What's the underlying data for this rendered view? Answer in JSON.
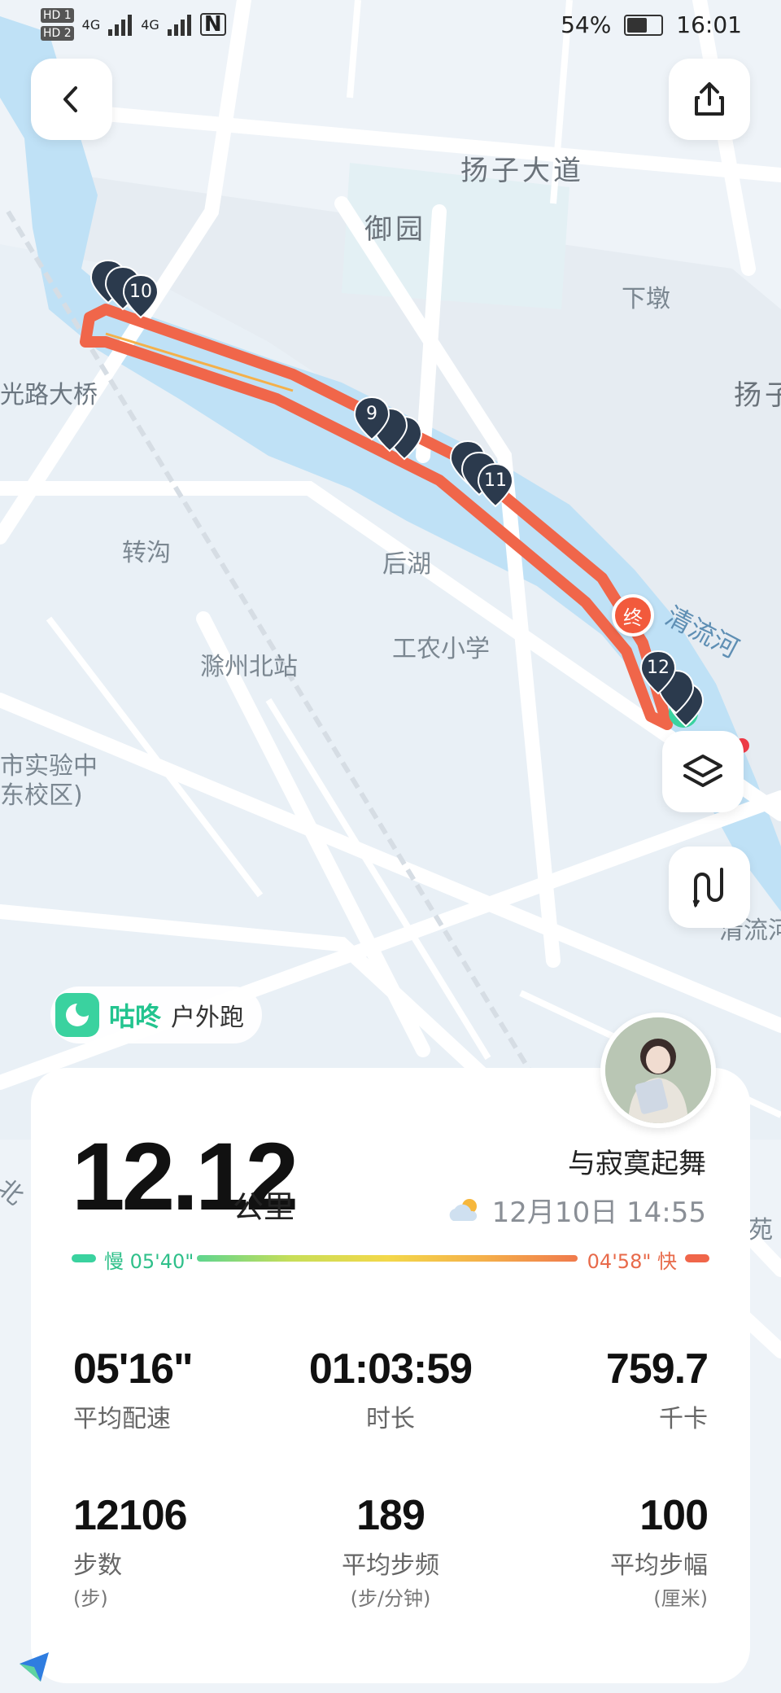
{
  "status_bar": {
    "hd1": "HD 1",
    "hd2": "HD 2",
    "signal1": "4G",
    "signal2": "4G",
    "nfc": "N",
    "battery": "54%",
    "time": "16:01"
  },
  "map": {
    "labels": {
      "yangzi_avenue": "扬子大道",
      "yuyuan": "御园",
      "xiadun": "下墩",
      "yangzi_right": "扬子",
      "bridge": "光路大桥",
      "zhuangou": "转沟",
      "houhu": "后湖",
      "gongnong_school": "工农小学",
      "chuzhou_north_station": "滁州北站",
      "school_line1": "市实验中",
      "school_line2": "东校区)",
      "qingliu_river": "清流河",
      "qingliu_river_2": "清流河",
      "bei_left": "北",
      "yuan_right": "苑"
    },
    "markers": {
      "km10": "10",
      "km9": "9",
      "km11": "11",
      "km12": "12",
      "end": "终"
    },
    "colors": {
      "route": "#f0664a",
      "water": "#bfe1f6",
      "end_marker": "#f25a3c",
      "start_marker": "#3ad29f",
      "pin": "#2b3a4d"
    }
  },
  "app": {
    "name": "咕咚",
    "activity": "户外跑"
  },
  "summary": {
    "distance": "12.12",
    "distance_unit": "公里",
    "username": "与寂寞起舞",
    "datetime": "12月10日 14:55",
    "pace_slow_label": "慢 05'40\"",
    "pace_fast_label": "04'58\" 快"
  },
  "stats": [
    {
      "value": "05'16\"",
      "label": "平均配速",
      "sub": ""
    },
    {
      "value": "01:03:59",
      "label": "时长",
      "sub": ""
    },
    {
      "value": "759.7",
      "label": "千卡",
      "sub": ""
    },
    {
      "value": "12106",
      "label": "步数",
      "sub": "(步)"
    },
    {
      "value": "189",
      "label": "平均步频",
      "sub": "(步/分钟)"
    },
    {
      "value": "100",
      "label": "平均步幅",
      "sub": "(厘米)"
    }
  ]
}
